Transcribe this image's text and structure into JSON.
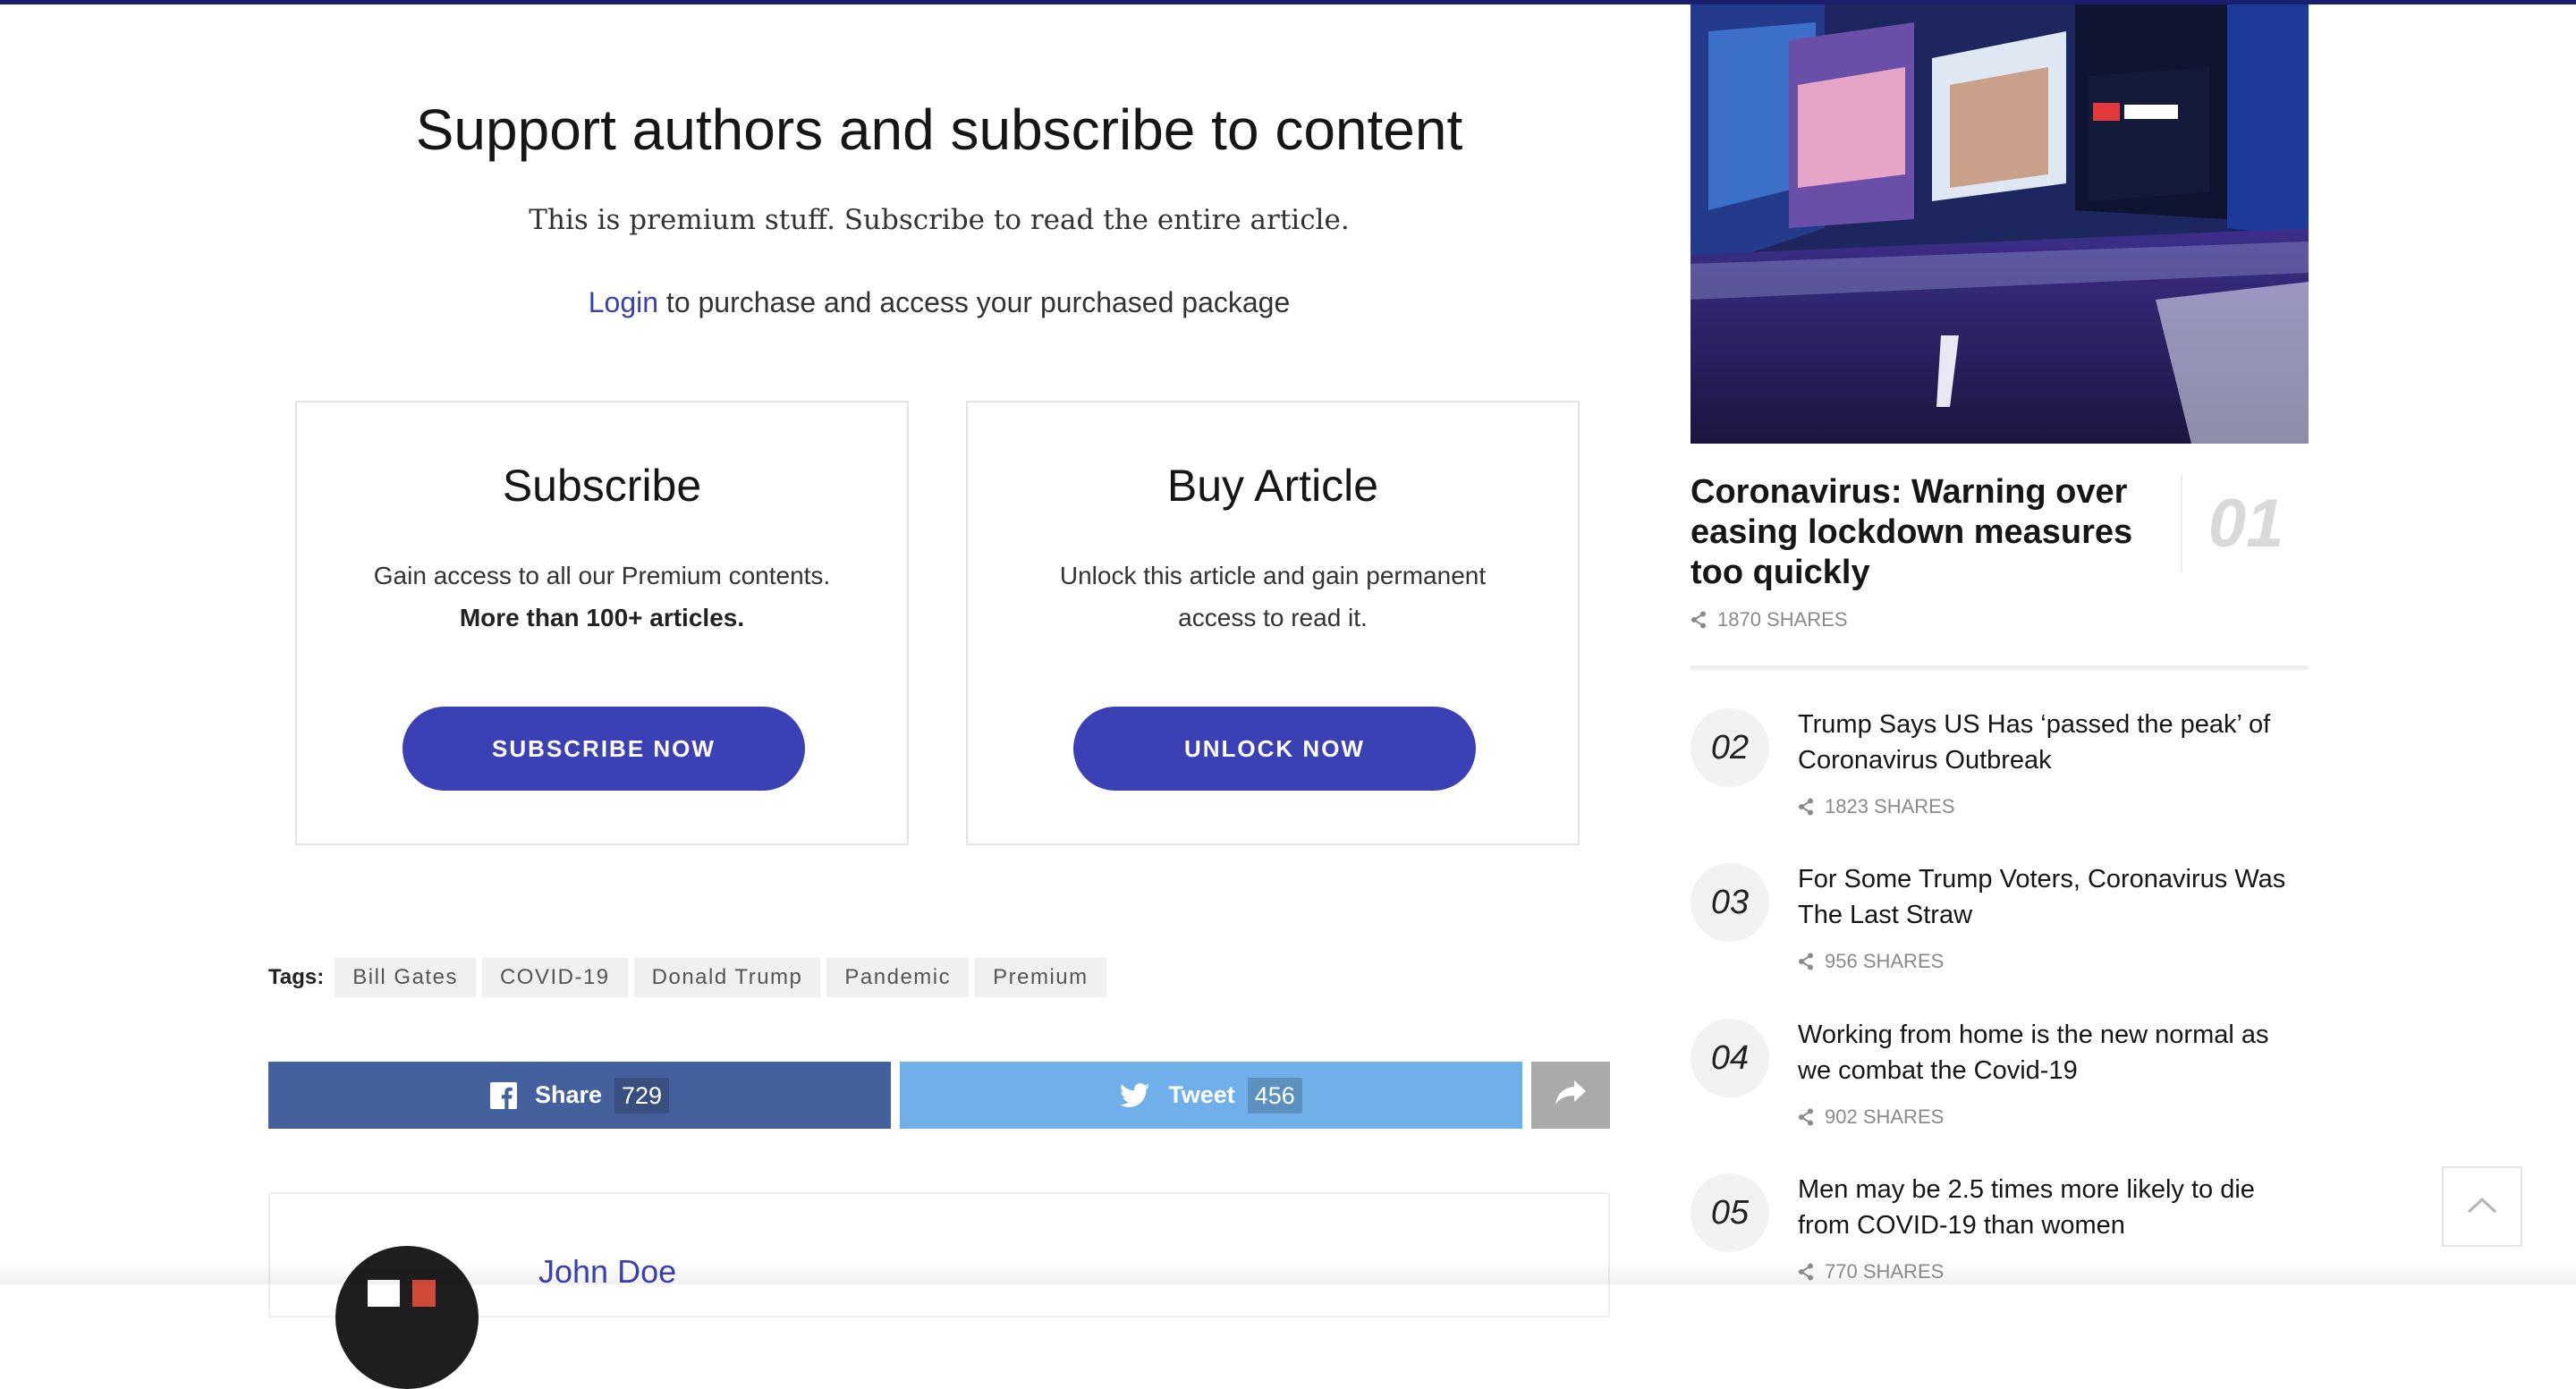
{
  "paywall": {
    "title": "Support authors and subscribe to content",
    "subtitle": "This is premium stuff. Subscribe to read the entire article.",
    "login_link": "Login",
    "login_text": " to purchase and access your purchased package"
  },
  "plans": [
    {
      "title": "Subscribe",
      "desc_line1": "Gain access to all our Premium contents.",
      "desc_bold": "More than 100+ articles.",
      "button": "SUBSCRIBE NOW"
    },
    {
      "title": "Buy Article",
      "desc_line1": "Unlock this article and gain permanent access to read it.",
      "desc_bold": "",
      "button": "UNLOCK NOW"
    }
  ],
  "tags": {
    "label": "Tags:",
    "items": [
      "Bill Gates",
      "COVID-19",
      "Donald Trump",
      "Pandemic",
      "Premium"
    ]
  },
  "share": {
    "facebook_label": "Share",
    "facebook_count": "729",
    "twitter_label": "Tweet",
    "twitter_count": "456",
    "facebook_color": "#45619d",
    "twitter_color": "#6fb0ea"
  },
  "author": {
    "name": "John Doe"
  },
  "sidebar": {
    "featured": {
      "rank": "01",
      "title": "Coronavirus: Warning over easing lockdown measures too quickly",
      "shares": "1870 SHARES",
      "image_icon": "times-square-photo"
    },
    "popular": [
      {
        "rank": "02",
        "title": "Trump Says US Has ‘passed the peak’ of Coronavirus Outbreak",
        "shares": "1823 SHARES"
      },
      {
        "rank": "03",
        "title": "For Some Trump Voters, Coronavirus Was The Last Straw",
        "shares": "956 SHARES"
      },
      {
        "rank": "04",
        "title": "Working from home is the new normal as we combat the Covid-19",
        "shares": "902 SHARES"
      },
      {
        "rank": "05",
        "title": "Men may be 2.5 times more likely to die from COVID-19 than women",
        "shares": "770 SHARES"
      }
    ]
  },
  "colors": {
    "accent": "#3b41b5",
    "top_bar": "#1c1f6e"
  }
}
